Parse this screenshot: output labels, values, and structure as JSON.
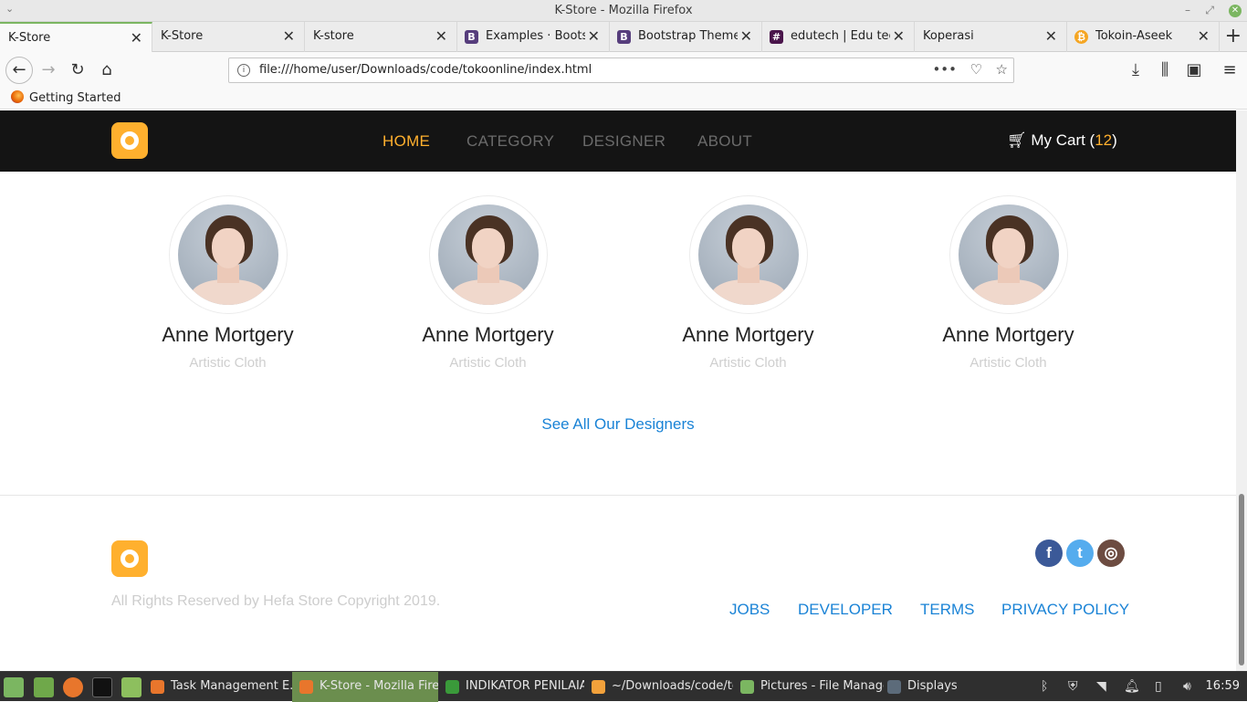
{
  "window": {
    "title": "K-Store - Mozilla Firefox"
  },
  "tabs": [
    {
      "label": "K-Store",
      "active": true
    },
    {
      "label": "K-Store"
    },
    {
      "label": "K-store"
    },
    {
      "label": "Examples · Bootstr",
      "icon": "bootstrap-icon",
      "color": "#563d7c"
    },
    {
      "label": "Bootstrap Themes",
      "icon": "bootstrap-icon",
      "color": "#563d7c"
    },
    {
      "label": "edutech | Edu tech",
      "icon": "slack-icon",
      "color": "#4a154b"
    },
    {
      "label": "Koperasi"
    },
    {
      "label": "Tokoin-Aseek",
      "icon": "coin-icon",
      "color": "#f5a623"
    }
  ],
  "toolbar": {
    "url": "file:///home/user/Downloads/code/tokoonline/index.html"
  },
  "bookmarks": {
    "getting_started": "Getting Started"
  },
  "site": {
    "accent": "#ffb02e",
    "nav": {
      "home": "HOME",
      "category": "CATEGORY",
      "designer": "DESIGNER",
      "about": "ABOUT",
      "cart_label": "My Cart (",
      "cart_count": "12",
      "cart_close": ")"
    },
    "designers": [
      {
        "name": "Anne Mortgery",
        "role": "Artistic Cloth"
      },
      {
        "name": "Anne Mortgery",
        "role": "Artistic Cloth"
      },
      {
        "name": "Anne Mortgery",
        "role": "Artistic Cloth"
      },
      {
        "name": "Anne Mortgery",
        "role": "Artistic Cloth"
      }
    ],
    "see_all": "See All Our Designers",
    "footer": {
      "copyright": "All Rights Reserved by Hefa Store Copyright 2019.",
      "links": [
        "JOBS",
        "DEVELOPER",
        "TERMS",
        "PRIVACY POLICY"
      ],
      "social": [
        {
          "icon": "facebook-icon",
          "glyph": "f",
          "color": "#3b5998"
        },
        {
          "icon": "twitter-icon",
          "glyph": "t",
          "color": "#55acee"
        },
        {
          "icon": "instagram-icon",
          "glyph": "◎",
          "color": "#6d4c41"
        }
      ]
    }
  },
  "taskbar": {
    "tasks": [
      {
        "label": "Task Management E...",
        "color": "#e8762c"
      },
      {
        "label": "K-Store - Mozilla Firef...",
        "color": "#e8762c",
        "active": true
      },
      {
        "label": "INDIKATOR PENILAIA...",
        "color": "#3a9a3a"
      },
      {
        "label": "~/Downloads/code/to...",
        "color": "#f2a13b"
      },
      {
        "label": "Pictures - File Manager",
        "color": "#7bb661"
      },
      {
        "label": "Displays",
        "color": "#5c6b7a"
      }
    ],
    "clock": "16:59"
  }
}
